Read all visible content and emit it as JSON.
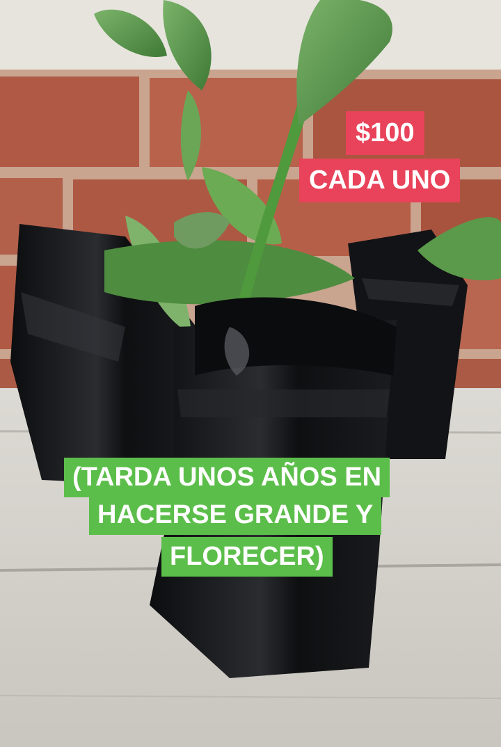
{
  "photo": {
    "subject": "plant-cuttings-in-black-bags",
    "colors": {
      "wall": "#e7e4dd",
      "brick": "#b05a45",
      "mortar": "#c9a48f",
      "floor": "#d8d5cf",
      "bag": "#111214",
      "leaf": "#5a9a4a"
    }
  },
  "price_tag": {
    "line1": "$100",
    "line2": "CADA UNO",
    "color": "#e8435a"
  },
  "note_tag": {
    "line1": "(TARDA UNOS AÑOS EN",
    "line2": "HACERSE GRANDE Y",
    "line3": "FLORECER)",
    "color": "#5cbe4a"
  }
}
